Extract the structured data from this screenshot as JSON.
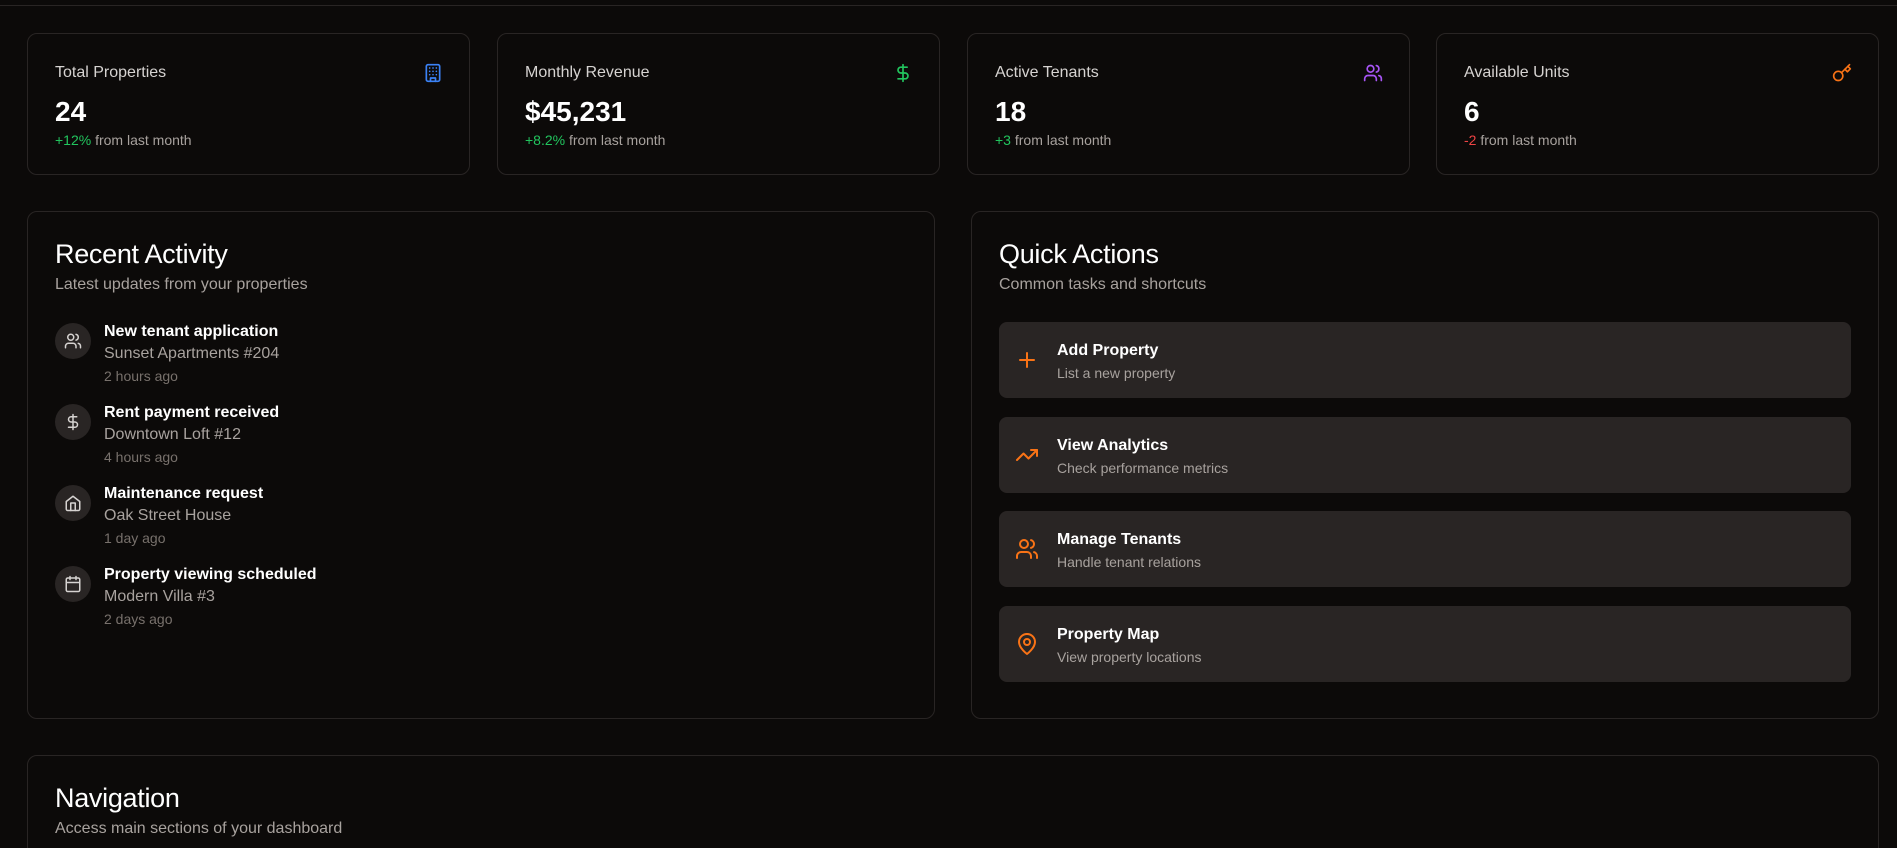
{
  "colors": {
    "background": "#0c0a09",
    "card_border": "#292524",
    "accent_orange": "#f97316",
    "positive": "#22c55e",
    "negative": "#ef4444",
    "blue_icon": "#3b82f6",
    "purple_icon": "#a855f7"
  },
  "stats": [
    {
      "title": "Total Properties",
      "value": "24",
      "delta": "+12%",
      "delta_suffix": " from last month",
      "icon": "building-icon"
    },
    {
      "title": "Monthly Revenue",
      "value": "$45,231",
      "delta": "+8.2%",
      "delta_suffix": " from last month",
      "icon": "dollar-icon"
    },
    {
      "title": "Active Tenants",
      "value": "18",
      "delta": "+3",
      "delta_suffix": " from last month",
      "icon": "users-icon"
    },
    {
      "title": "Available Units",
      "value": "6",
      "delta": "-2",
      "delta_suffix": " from last month",
      "icon": "key-icon"
    }
  ],
  "recent_activity": {
    "title": "Recent Activity",
    "subtitle": "Latest updates from your properties",
    "items": [
      {
        "title": "New tenant application",
        "subtitle": "Sunset Apartments #204",
        "time": "2 hours ago",
        "icon": "users-icon"
      },
      {
        "title": "Rent payment received",
        "subtitle": "Downtown Loft #12",
        "time": "4 hours ago",
        "icon": "dollar-icon"
      },
      {
        "title": "Maintenance request",
        "subtitle": "Oak Street House",
        "time": "1 day ago",
        "icon": "home-icon"
      },
      {
        "title": "Property viewing scheduled",
        "subtitle": "Modern Villa #3",
        "time": "2 days ago",
        "icon": "calendar-icon"
      }
    ]
  },
  "quick_actions": {
    "title": "Quick Actions",
    "subtitle": "Common tasks and shortcuts",
    "items": [
      {
        "title": "Add Property",
        "subtitle": "List a new property",
        "icon": "plus-icon"
      },
      {
        "title": "View Analytics",
        "subtitle": "Check performance metrics",
        "icon": "trending-up-icon"
      },
      {
        "title": "Manage Tenants",
        "subtitle": "Handle tenant relations",
        "icon": "users-icon"
      },
      {
        "title": "Property Map",
        "subtitle": "View property locations",
        "icon": "map-pin-icon"
      }
    ]
  },
  "navigation": {
    "title": "Navigation",
    "subtitle": "Access main sections of your dashboard"
  }
}
